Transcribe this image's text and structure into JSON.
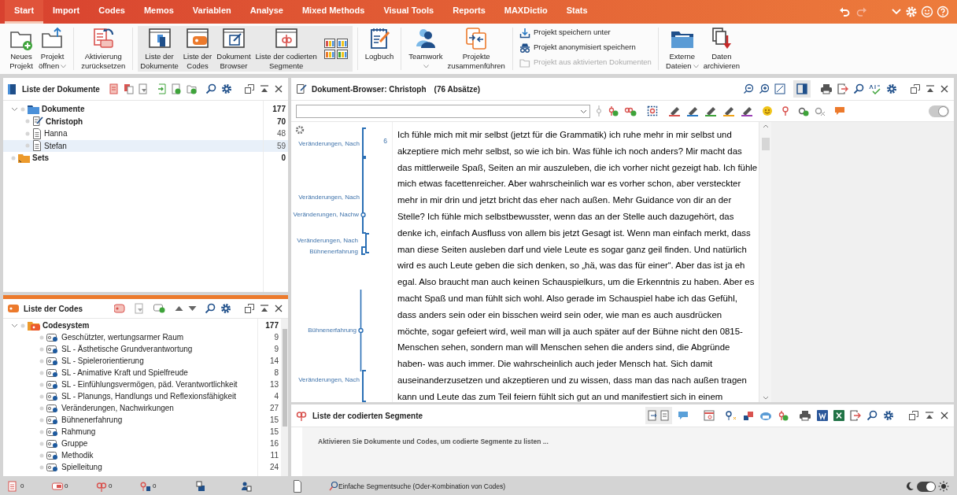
{
  "menu_tabs": [
    {
      "label": "Start",
      "selected": true
    },
    {
      "label": "Import",
      "selected": false
    },
    {
      "label": "Codes",
      "selected": false
    },
    {
      "label": "Memos",
      "selected": false
    },
    {
      "label": "Variablen",
      "selected": false
    },
    {
      "label": "Analyse",
      "selected": false
    },
    {
      "label": "Mixed Methods",
      "selected": false
    },
    {
      "label": "Visual Tools",
      "selected": false
    },
    {
      "label": "Reports",
      "selected": false
    },
    {
      "label": "MAXDictio",
      "selected": false
    },
    {
      "label": "Stats",
      "selected": false
    }
  ],
  "ribbon": [
    {
      "kind": "button",
      "lines": [
        "Neues",
        "Projekt"
      ],
      "dropdown": false,
      "selected": false
    },
    {
      "kind": "button",
      "lines": [
        "Projekt",
        "öffnen"
      ],
      "dropdown": true,
      "selected": false
    },
    {
      "kind": "separator"
    },
    {
      "kind": "button",
      "lines": [
        "Aktivierung",
        "zurücksetzen"
      ],
      "dropdown": false,
      "selected": false
    },
    {
      "kind": "separator"
    },
    {
      "kind": "button",
      "lines": [
        "Liste der",
        "Dokumente"
      ],
      "dropdown": false,
      "selected": true
    },
    {
      "kind": "button",
      "lines": [
        "Liste der",
        "Codes"
      ],
      "dropdown": false,
      "selected": true
    },
    {
      "kind": "button",
      "lines": [
        "Dokument",
        "Browser"
      ],
      "dropdown": false,
      "selected": true
    },
    {
      "kind": "button",
      "lines": [
        "Liste der codierten",
        "Segmente"
      ],
      "dropdown": false,
      "selected": true
    },
    {
      "kind": "layouts"
    },
    {
      "kind": "separator"
    },
    {
      "kind": "button",
      "lines": [
        "Logbuch"
      ],
      "dropdown": false,
      "selected": false
    },
    {
      "kind": "separator"
    },
    {
      "kind": "button",
      "lines": [
        "Teamwork"
      ],
      "dropdown": true,
      "selected": false
    },
    {
      "kind": "button",
      "lines": [
        "Projekte",
        "zusammenführen"
      ],
      "dropdown": false,
      "selected": false
    },
    {
      "kind": "separator"
    },
    {
      "kind": "stack",
      "items": [
        {
          "label": "Projekt speichern unter",
          "disabled": false
        },
        {
          "label": "Projekt anonymisiert speichern",
          "disabled": false
        },
        {
          "label": "Projekt aus aktivierten Dokumenten",
          "disabled": true
        }
      ]
    },
    {
      "kind": "separator"
    },
    {
      "kind": "button",
      "lines": [
        "Externe",
        "Dateien"
      ],
      "dropdown": true,
      "selected": false
    },
    {
      "kind": "button",
      "lines": [
        "Daten",
        "archivieren"
      ],
      "dropdown": false,
      "selected": false
    }
  ],
  "documents_panel": {
    "title": "Liste der Dokumente",
    "tree": [
      {
        "label": "Dokumente",
        "count": "177",
        "kind": "folder",
        "bold": true,
        "selected": false,
        "expanded": true,
        "children": [
          {
            "label": "Christoph",
            "count": "70",
            "kind": "opened",
            "bold": true,
            "selected": false
          },
          {
            "label": "Hanna",
            "count": "48",
            "kind": "document",
            "bold": false,
            "selected": false
          },
          {
            "label": "Stefan",
            "count": "59",
            "kind": "document",
            "bold": false,
            "selected": true
          }
        ]
      },
      {
        "label": "Sets",
        "count": "0",
        "kind": "sets",
        "bold": true,
        "selected": false
      }
    ]
  },
  "codes_panel": {
    "title": "Liste der Codes",
    "tree": [
      {
        "label": "Codesystem",
        "count": "177",
        "expanded": true,
        "children": [
          {
            "label": "Geschützter, wertungsarmer Raum",
            "count": "9"
          },
          {
            "label": "SL - Ästhetische Grundverantwortung",
            "count": "9"
          },
          {
            "label": "SL - Spielerorientierung",
            "count": "14"
          },
          {
            "label": "SL - Animative Kraft und Spielfreude",
            "count": "8"
          },
          {
            "label": "SL - Einfühlungsvermögen, päd. Verantwortlichkeit",
            "count": "13"
          },
          {
            "label": "SL - Planungs, Handlungs und Reflexionsfähigkeit",
            "count": "4"
          },
          {
            "label": "Veränderungen, Nachwirkungen",
            "count": "27"
          },
          {
            "label": "Bühnenerfahrung",
            "count": "15"
          },
          {
            "label": "Rahmung",
            "count": "15"
          },
          {
            "label": "Gruppe",
            "count": "16"
          },
          {
            "label": "Methodik",
            "count": "11"
          },
          {
            "label": "Spielleitung",
            "count": "24"
          }
        ]
      }
    ]
  },
  "document_browser": {
    "title": "Dokument-Browser: Christoph",
    "paragraphs": "(76 Absätze)",
    "paragraph_number": "6",
    "edit_mode": true,
    "side_panel": true,
    "coding_stripes": [
      {
        "label": "Veränderungen, Nach"
      },
      {
        "label": "Veränderungen, Nach"
      },
      {
        "label": "Veränderungen, Nachw"
      },
      {
        "label": "Veränderungen, Nach"
      },
      {
        "label": "Bühnenerfahrung"
      },
      {
        "label": "Bühnenerfahrung"
      },
      {
        "label": "Veränderungen, Nach"
      }
    ],
    "lines": [
      "Ich fühle mich mit mir selbst (jetzt für die Grammatik) ich ruhe mehr in mir selbst und",
      "akzeptiere mich mehr selbst, so wie ich bin. Was fühle ich noch anders? Mir macht das",
      "das mittlerweile Spaß, Seiten an mir auszuleben, die ich vorher nicht gezeigt hab. Ich fühle",
      "mich etwas facettenreicher. Aber wahrscheinlich war es vorher schon, aber versteckter",
      "mehr in mir drin und jetzt bricht das eher nach außen. Mehr Guidance von dir an der",
      "Stelle? Ich fühle mich selbstbewusster, wenn das an der Stelle auch dazugehört, das",
      "denke ich, einfach Ausfluss von allem bis jetzt Gesagt ist. Wenn man einfach merkt, dass",
      "man diese Seiten ausleben darf und viele Leute es sogar ganz geil finden. Und natürlich",
      "wird es auch Leute geben die sich denken, so „hä, was das für einer“. Aber das ist ja eh",
      "egal. Also braucht man auch keinen Schauspielkurs, um die Erkenntnis zu haben. Aber es",
      "macht Spaß und man fühlt sich wohl. Also gerade im Schauspiel habe ich das Gefühl,",
      "dass anders sein oder ein bisschen weird sein oder, wie man es auch ausdrücken",
      "möchte, sogar gefeiert wird, weil man will ja auch später auf der Bühne nicht den 0815-",
      "Menschen sehen, sondern man will Menschen sehen die anders sind, die Abgründe",
      "haben- was auch immer. Die wahrscheinlich auch jeder Mensch hat. Sich damit",
      "auseinanderzusetzen und akzeptieren und zu wissen, dass man das nach außen tragen",
      "kann und Leute das zum Teil feiern fühlt sich gut an und manifestiert sich in einem"
    ]
  },
  "segments_panel": {
    "title": "Liste der codierten Segmente",
    "document_view": true,
    "message": "Aktivieren Sie Dokumente und Codes, um codierte Segmente zu listen ..."
  },
  "status_bar": {
    "counters": [
      {
        "count": "0"
      },
      {
        "count": "0"
      },
      {
        "count": "0"
      },
      {
        "count": "0"
      }
    ],
    "search_mode": "Einfache Segmentsuche (Oder-Kombination von Codes)",
    "light_mode": true
  }
}
